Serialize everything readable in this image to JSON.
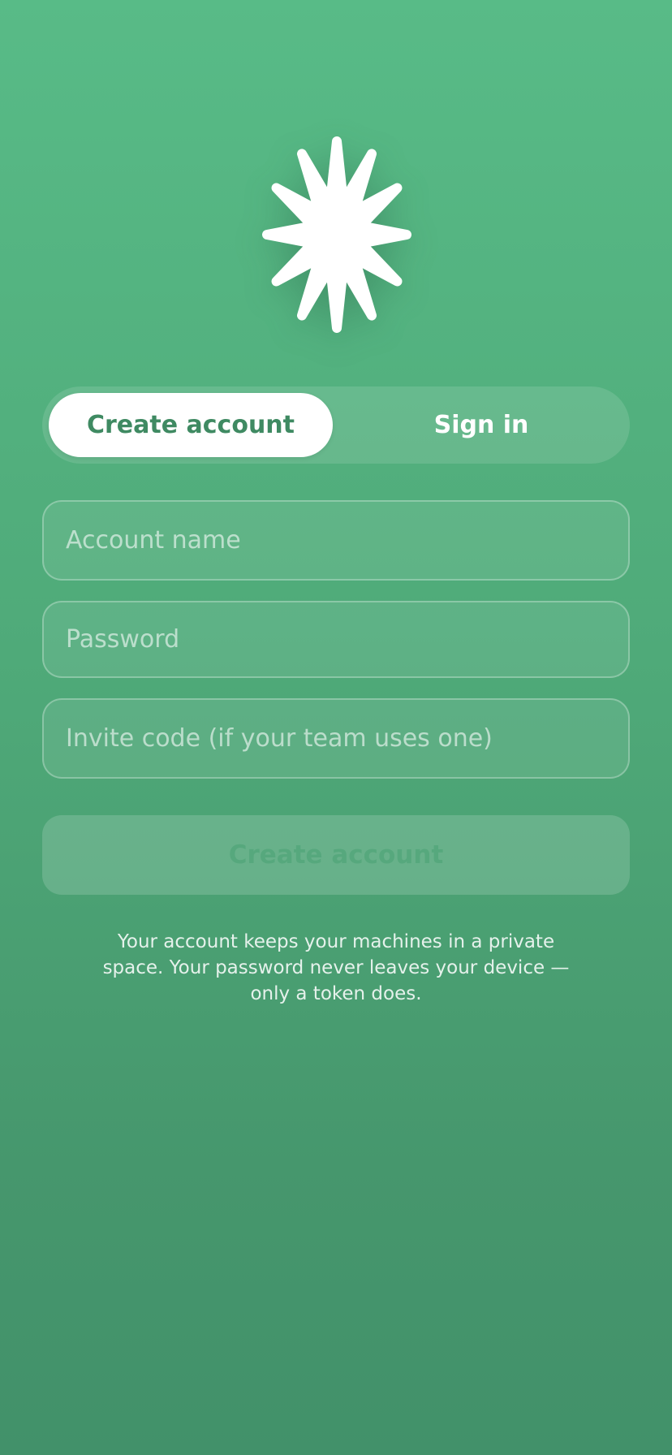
{
  "app": {
    "logo_icon": "asterisk-star-icon",
    "accent_color": "#4f9f73"
  },
  "mode_switch": {
    "active": "Create account",
    "options": [
      "Create account",
      "Sign in"
    ]
  },
  "form": {
    "account_name": {
      "value": "",
      "placeholder": "Account name"
    },
    "password": {
      "value": "",
      "placeholder": "Password"
    },
    "invite_code": {
      "value": "",
      "placeholder": "Invite code (if your team uses one)"
    }
  },
  "submit": {
    "label": "Create account",
    "enabled": false
  },
  "footer_note": "Your account keeps your machines in a private space. Your password never leaves your device — only a token does."
}
